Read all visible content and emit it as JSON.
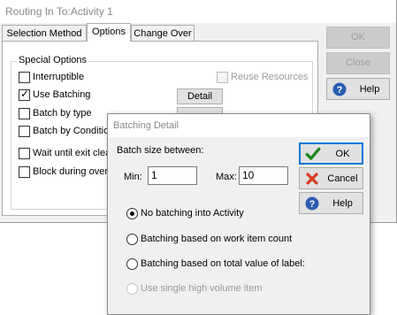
{
  "routing_window": {
    "title": "Routing In To:Activity 1",
    "tabs": [
      {
        "label": "Selection Method"
      },
      {
        "label": "Options"
      },
      {
        "label": "Change Over"
      }
    ],
    "group_label": "Special Options",
    "options": {
      "interruptible": {
        "label": "Interruptible",
        "checked": false
      },
      "use_batching": {
        "label": "Use Batching",
        "checked": true
      },
      "batch_by_type": {
        "label": "Batch by type",
        "checked": false
      },
      "batch_by_condition": {
        "label": "Batch by Condition",
        "checked": false
      },
      "wait_until_exit": {
        "label": "Wait until exit clear",
        "checked": false
      },
      "block_during_overtime": {
        "label": "Block during overtime",
        "checked": false
      },
      "reuse_resources": {
        "label": "Reuse Resources",
        "checked": false,
        "enabled": false
      }
    },
    "detail_label": "Detail",
    "buttons": {
      "ok": "OK",
      "close": "Close",
      "help": "Help"
    }
  },
  "batching_dialog": {
    "title": "Batching Detail",
    "batch_size_label": "Batch size between:",
    "min_label": "Min:",
    "min_value": "1",
    "max_label": "Max:",
    "max_value": "10",
    "buttons": {
      "ok": "OK",
      "cancel": "Cancel",
      "help": "Help"
    },
    "radio_options": [
      {
        "label": "No batching into Activity",
        "selected": true,
        "enabled": true
      },
      {
        "label": "Batching based on work item count",
        "selected": false,
        "enabled": true
      },
      {
        "label": "Batching based on total value of label:",
        "selected": false,
        "enabled": true
      },
      {
        "label": "Use single high volume item",
        "selected": false,
        "enabled": false
      }
    ]
  },
  "colors": {
    "accent": "#0078d7",
    "ok_check": "#1e8a1e",
    "cancel_x": "#d83b1e",
    "help_blue": "#2a5db0"
  }
}
